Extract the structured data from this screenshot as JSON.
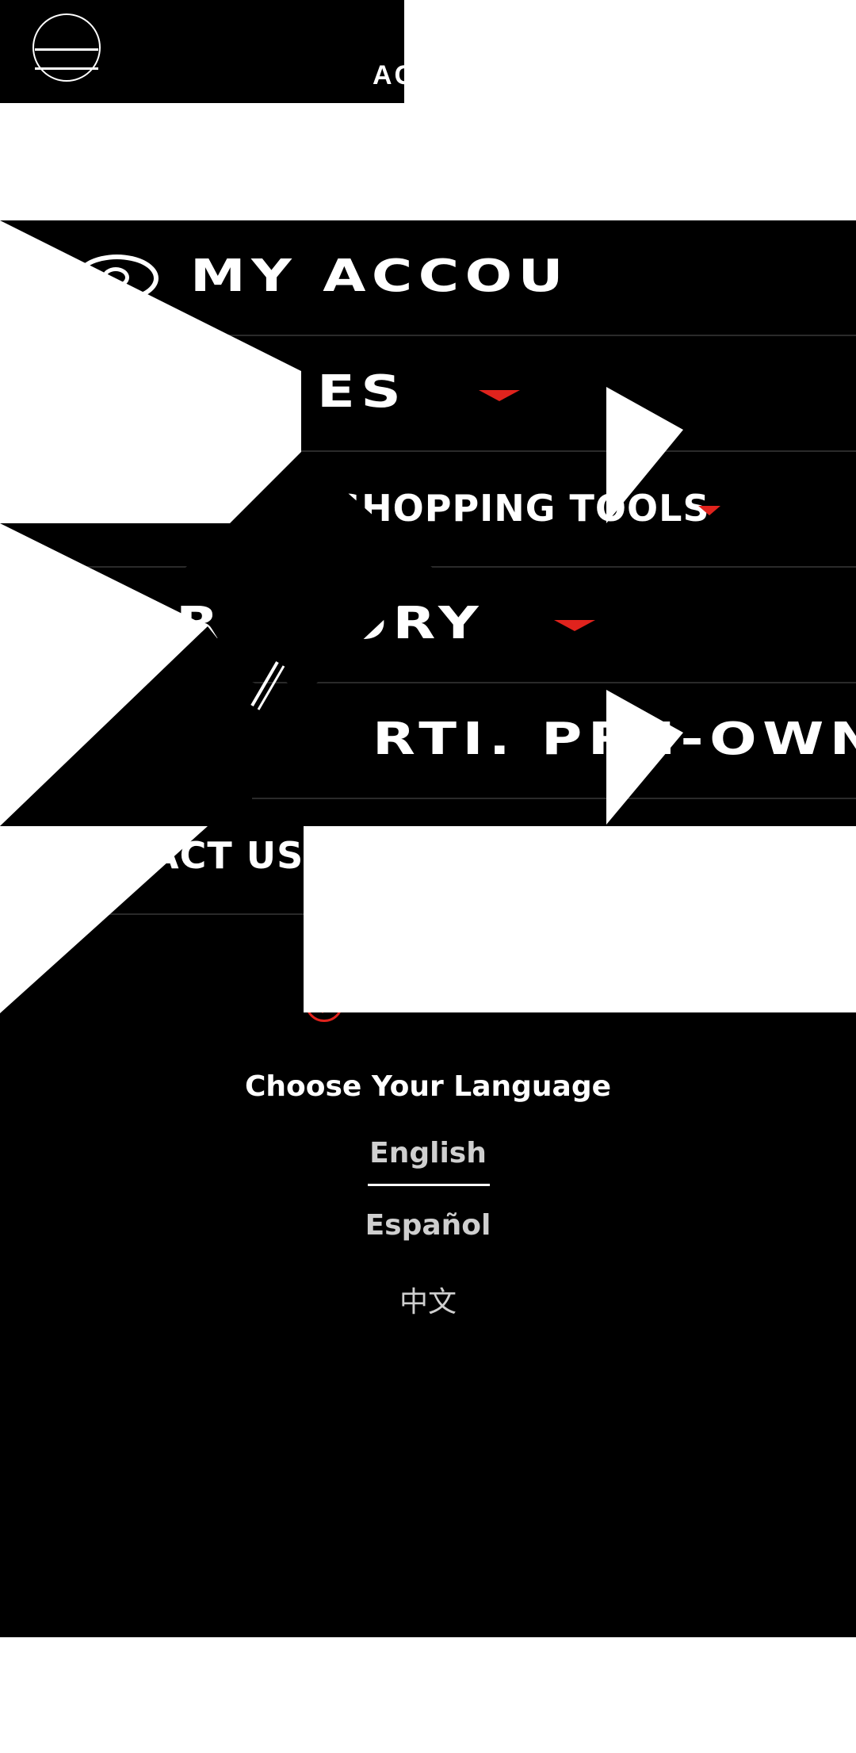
{
  "header": {
    "menu_icon": "menu-circle-icon",
    "partial_text": "AC"
  },
  "menu": {
    "my_account": "MY ACCOU",
    "vehicles": "ES",
    "shopping_tools": "SHOPPING TOOLS",
    "our_story": "R STORY",
    "pre_owned": "RTI. PRE-OWN.",
    "contact_us": "ACT US"
  },
  "icons": {
    "account": "account-icon",
    "tools": "tools-icon",
    "dropdown": "caret-down-icon",
    "language": "globe-icon"
  },
  "language": {
    "title": "Choose Your Language",
    "options": [
      "English",
      "Español",
      "中文"
    ],
    "selected": "English"
  },
  "colors": {
    "accent": "#e0231d",
    "background": "#000000",
    "text": "#ffffff"
  }
}
